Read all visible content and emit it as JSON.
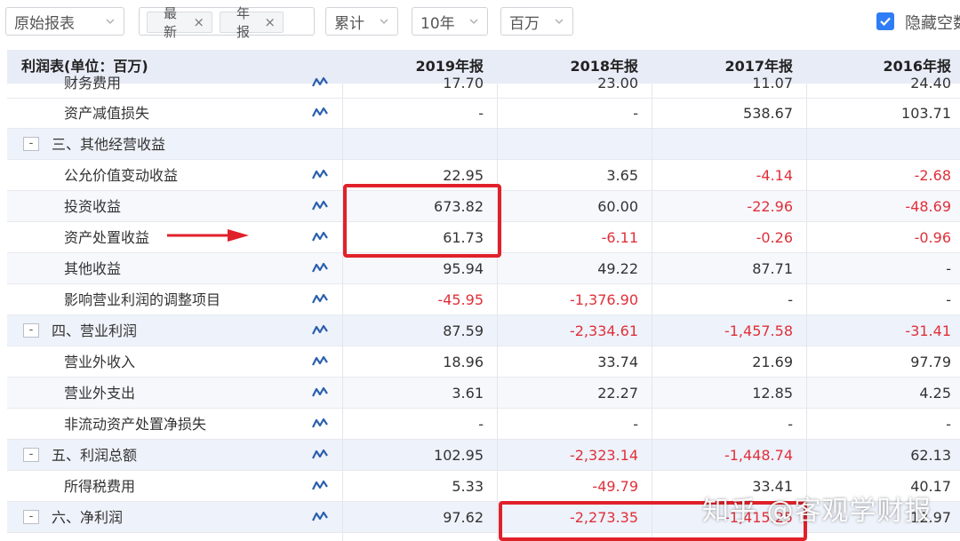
{
  "toolbar": {
    "report_type": "原始报表",
    "tags": [
      "最新",
      "年报"
    ],
    "mode": "累计",
    "years": "10年",
    "unit": "百万",
    "hide_empty_label": "隐藏空数据",
    "hide_empty_checked": true
  },
  "table": {
    "header": [
      "利润表(单位：百万)",
      "2019年报",
      "2018年报",
      "2017年报",
      "2016年报"
    ],
    "partial_top_row": {
      "label": "财务费用",
      "values": [
        "17.70",
        "23.00",
        "11.07",
        "24.40"
      ]
    },
    "rows": [
      {
        "label": "资产减值损失",
        "indent": 2,
        "spark": true,
        "values": [
          "-",
          "-",
          "538.67",
          "103.71"
        ]
      },
      {
        "label": "三、其他经营收益",
        "indent": 1,
        "section": true,
        "spark": false,
        "values": [
          "",
          "",
          "",
          ""
        ]
      },
      {
        "label": "公允价值变动收益",
        "indent": 2,
        "spark": true,
        "values": [
          "22.95",
          "3.65",
          "-4.14",
          "-2.68"
        ]
      },
      {
        "label": "投资收益",
        "indent": 2,
        "spark": true,
        "values": [
          "673.82",
          "60.00",
          "-22.96",
          "-48.69"
        ]
      },
      {
        "label": "资产处置收益",
        "indent": 2,
        "spark": true,
        "values": [
          "61.73",
          "-6.11",
          "-0.26",
          "-0.96"
        ]
      },
      {
        "label": "其他收益",
        "indent": 2,
        "spark": true,
        "values": [
          "95.94",
          "49.22",
          "87.71",
          "-"
        ]
      },
      {
        "label": "影响营业利润的调整项目",
        "indent": 2,
        "spark": true,
        "values": [
          "-45.95",
          "-1,376.90",
          "-",
          "-"
        ]
      },
      {
        "label": "四、营业利润",
        "indent": 1,
        "section": true,
        "spark": true,
        "values": [
          "87.59",
          "-2,334.61",
          "-1,457.58",
          "-31.41"
        ]
      },
      {
        "label": "营业外收入",
        "indent": 2,
        "spark": true,
        "values": [
          "18.96",
          "33.74",
          "21.69",
          "97.79"
        ]
      },
      {
        "label": "营业外支出",
        "indent": 2,
        "spark": true,
        "values": [
          "3.61",
          "22.27",
          "12.85",
          "4.25"
        ]
      },
      {
        "label": "非流动资产处置净损失",
        "indent": 2,
        "spark": true,
        "values": [
          "-",
          "-",
          "-",
          "-"
        ]
      },
      {
        "label": "五、利润总额",
        "indent": 1,
        "section": true,
        "spark": true,
        "values": [
          "102.95",
          "-2,323.14",
          "-1,448.74",
          "62.13"
        ]
      },
      {
        "label": "所得税费用",
        "indent": 2,
        "spark": true,
        "values": [
          "5.33",
          "-49.79",
          "33.41",
          "40.17"
        ]
      },
      {
        "label": "六、净利润",
        "indent": 1,
        "section": true,
        "spark": true,
        "values": [
          "97.62",
          "-2,273.35",
          "-1,415.25",
          "12.97"
        ]
      }
    ]
  },
  "watermark": "知乎 @客观学财报",
  "colors": {
    "negative": "#e0303a",
    "accent": "#2f7df6",
    "annotation": "#e0212a",
    "header_bg": "#e8ecf7"
  }
}
